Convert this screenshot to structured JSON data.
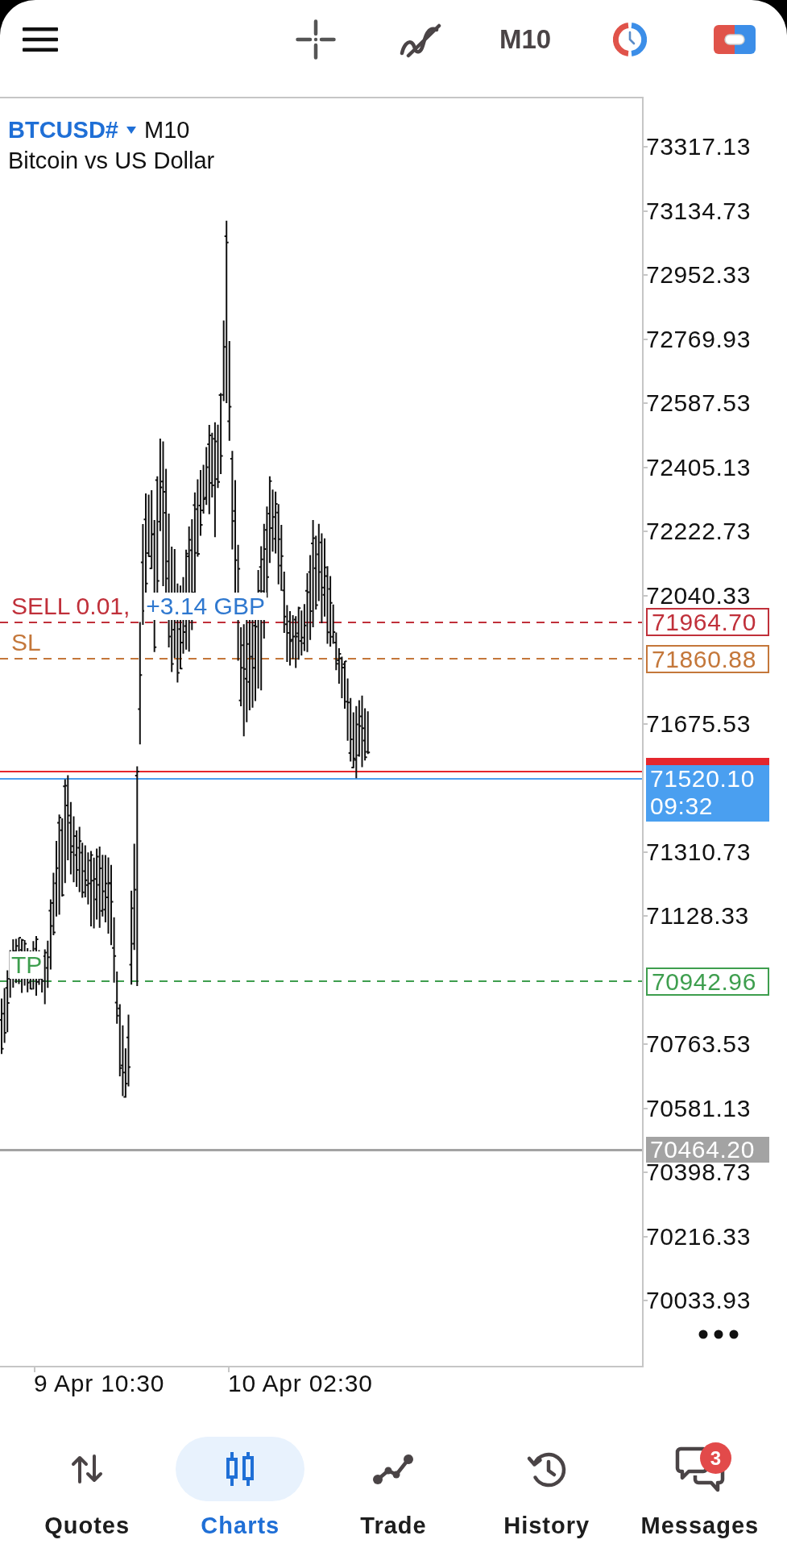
{
  "top_bar": {
    "timeframe": "M10"
  },
  "chart": {
    "symbol": "BTCUSD#",
    "timeframe": "M10",
    "description": "Bitcoin vs US Dollar",
    "price_axis": [
      "73317.13",
      "73134.73",
      "72952.33",
      "72769.93",
      "72587.53",
      "72405.13",
      "72222.73",
      "72040.33",
      "71675.53",
      "71310.73",
      "71128.33",
      "70763.53",
      "70581.13",
      "70398.73",
      "70216.33",
      "70033.93"
    ],
    "time_axis": [
      "9 Apr 10:30",
      "10 Apr 02:30"
    ],
    "levels": [
      {
        "kind": "order",
        "label": "SELL 0.01,",
        "profit": "+3.14 GBP",
        "price": "71964.70",
        "color": "#c0303a"
      },
      {
        "kind": "stop_loss",
        "label": "SL",
        "price": "71860.88",
        "color": "#c4773a"
      },
      {
        "kind": "ask",
        "color": "#e5262d"
      },
      {
        "kind": "bid",
        "price": "71520.10",
        "time": "09:32",
        "color": "#4a9ff0"
      },
      {
        "kind": "take_profit",
        "label": "TP",
        "price": "70942.96",
        "color": "#3e9e4e"
      },
      {
        "kind": "line",
        "price": "70464.20",
        "color": "#a3a3a3"
      }
    ]
  },
  "bottom_nav": [
    {
      "label": "Quotes",
      "selected": false
    },
    {
      "label": "Charts",
      "selected": true
    },
    {
      "label": "Trade",
      "selected": false
    },
    {
      "label": "History",
      "selected": false
    },
    {
      "label": "Messages",
      "selected": false,
      "badge": "3"
    }
  ]
}
